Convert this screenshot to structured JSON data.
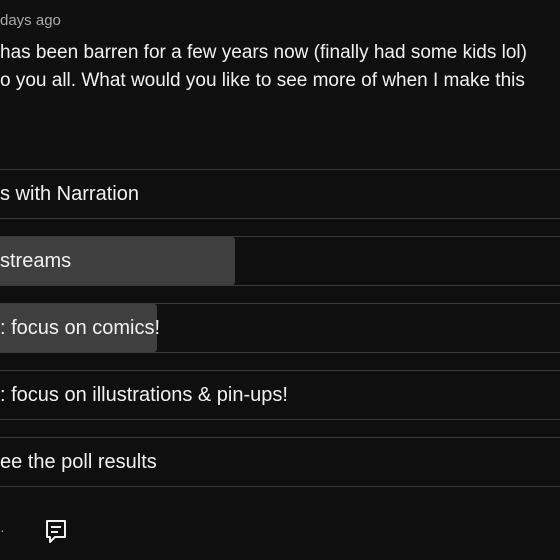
{
  "post": {
    "timestamp": "days ago",
    "body_lines": [
      "has been barren for a few years now (finally had some kids lol)",
      "o you all. What would you like to see more of when I make this"
    ]
  },
  "poll": {
    "options": [
      {
        "label": "s with Narration",
        "percent": 0
      },
      {
        "label": "streams",
        "percent": 42
      },
      {
        "label": ": focus on comics!",
        "percent": 28
      },
      {
        "label": ": focus on illustrations & pin-ups!",
        "percent": 0
      },
      {
        "label": "ee the poll results",
        "percent": 0
      }
    ]
  },
  "actions": {
    "icons": [
      "thumb-icon",
      "comment-icon"
    ]
  },
  "colors": {
    "background": "#0f0f0f",
    "text": "#f1f1f1",
    "secondary_text": "#aaaaaa",
    "bar_fill": "#3f3f3f",
    "divider": "#3a3a3a"
  }
}
